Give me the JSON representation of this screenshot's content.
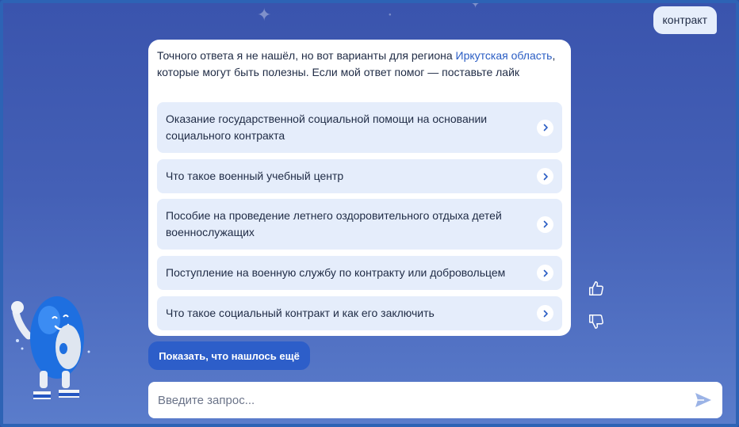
{
  "chat": {
    "user_message": "контракт",
    "bot": {
      "intro_before": "Точного ответа я не нашёл, но вот варианты для региона ",
      "intro_link": "Иркутская область",
      "intro_after": ", которые могут быть полезны. Если мой ответ помог — поставьте лайк",
      "options": [
        {
          "label": "Оказание государственной социальной помощи на основании социального контракта"
        },
        {
          "label": "Что такое военный учебный центр"
        },
        {
          "label": "Пособие на проведение летнего оздоровительного отдыха детей военнослужащих"
        },
        {
          "label": "Поступление на военную службу по контракту или добровольцем"
        },
        {
          "label": "Что такое социальный контракт и как его заключить"
        }
      ]
    },
    "show_more_label": "Показать, что нашлось ещё"
  },
  "input": {
    "placeholder": "Введите запрос...",
    "value": ""
  },
  "icons": {
    "like": "thumbs-up-icon",
    "dislike": "thumbs-down-icon",
    "send": "send-icon",
    "option_arrow": "chevron-right-icon"
  },
  "colors": {
    "background": "#3a54ad",
    "accent": "#2d5ec9",
    "option_bg": "#e5edfb",
    "link": "#2a5dc4"
  }
}
